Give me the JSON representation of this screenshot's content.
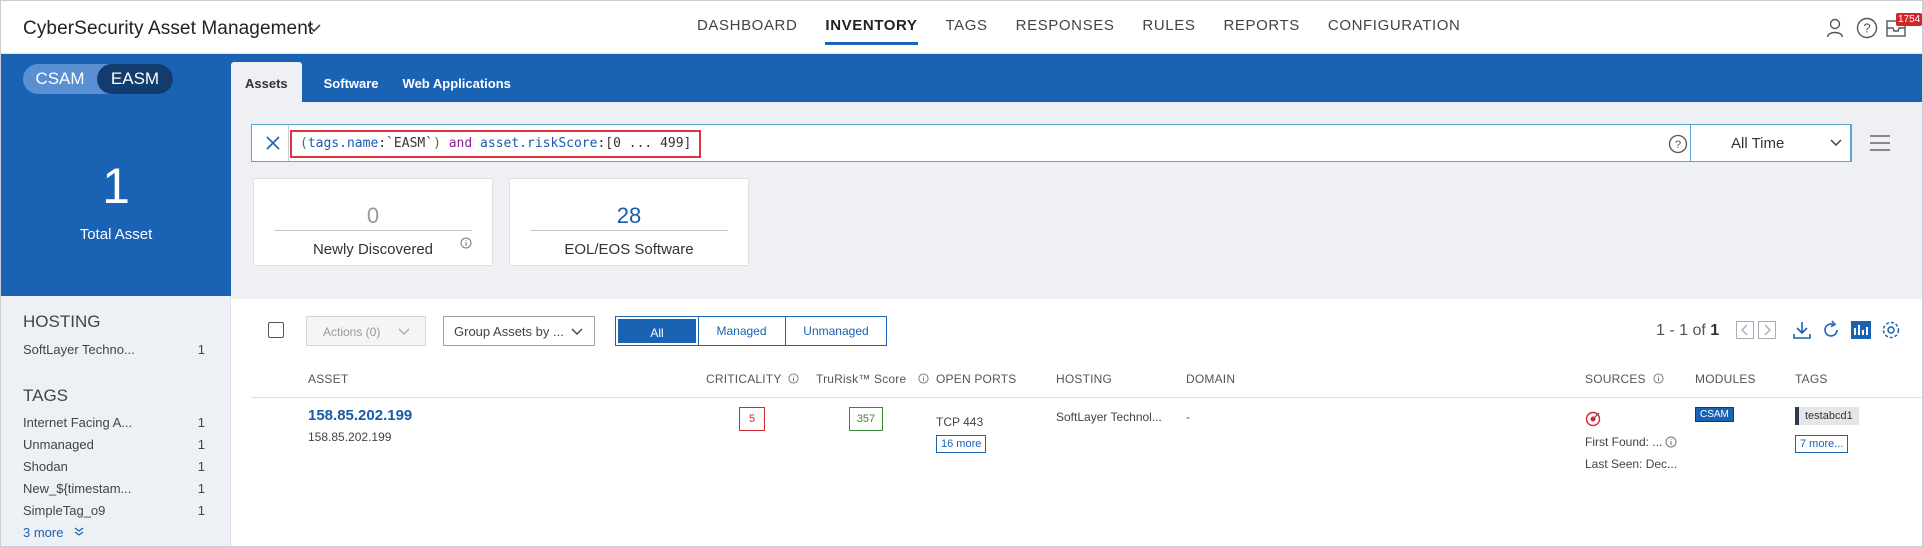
{
  "app": {
    "title": "CyberSecurity Asset Management",
    "notification_count": "1754"
  },
  "nav": [
    {
      "label": "DASHBOARD",
      "active": false
    },
    {
      "label": "INVENTORY",
      "active": true
    },
    {
      "label": "TAGS",
      "active": false
    },
    {
      "label": "RESPONSES",
      "active": false
    },
    {
      "label": "RULES",
      "active": false
    },
    {
      "label": "REPORTS",
      "active": false
    },
    {
      "label": "CONFIGURATION",
      "active": false
    }
  ],
  "mode_toggle": {
    "csam": "CSAM",
    "easm": "EASM",
    "selected": "EASM"
  },
  "subtabs": [
    {
      "label": "Assets",
      "active": true
    },
    {
      "label": "Software",
      "active": false
    },
    {
      "label": "Web Applications",
      "active": false
    }
  ],
  "summary": {
    "total": "1",
    "total_label": "Total Asset"
  },
  "search": {
    "q_open": "(",
    "q_key1": "tags.name",
    "q_colon1": ":`EASM`",
    "q_close": ")",
    "q_and": " and ",
    "q_key2": "asset.riskScore",
    "q_range": ":[0 ... 499]",
    "time_range": "All Time"
  },
  "cards": [
    {
      "value": "0",
      "label": "Newly Discovered"
    },
    {
      "value": "28",
      "label": "EOL/EOS Software"
    }
  ],
  "filters": {
    "hosting_title": "HOSTING",
    "hosting": [
      {
        "label": "SoftLayer Techno...",
        "count": "1"
      }
    ],
    "tags_title": "TAGS",
    "tags": [
      {
        "label": "Internet Facing A...",
        "count": "1"
      },
      {
        "label": "Unmanaged",
        "count": "1"
      },
      {
        "label": "Shodan",
        "count": "1"
      },
      {
        "label": "New_${timestam...",
        "count": "1"
      },
      {
        "label": "SimpleTag_o9",
        "count": "1"
      }
    ],
    "more": "3 more"
  },
  "toolbar": {
    "actions": "Actions (0)",
    "group_by": "Group Assets by ...",
    "segments": [
      "All",
      "Managed",
      "Unmanaged"
    ],
    "pager_range": "1 - 1 of",
    "pager_total": "1"
  },
  "columns": {
    "asset": "ASSET",
    "criticality": "CRITICALITY",
    "trurisk": "TruRisk™ Score",
    "open_ports": "OPEN PORTS",
    "hosting": "HOSTING",
    "domain": "DOMAIN",
    "sources": "SOURCES",
    "modules": "MODULES",
    "tags": "TAGS"
  },
  "rows": [
    {
      "asset_name": "158.85.202.199",
      "asset_ip": "158.85.202.199",
      "criticality": "5",
      "score": "357",
      "port": "TCP 443",
      "ports_more": "16 more",
      "hosting": "SoftLayer Technol...",
      "domain": "-",
      "first_found": "First Found: ...",
      "last_seen": "Last Seen: Dec...",
      "module": "CSAM",
      "tag": "testabcd1",
      "tags_more": "7 more..."
    }
  ],
  "colors": {
    "brand_blue": "#1a62b3",
    "critical_red": "#d1262b",
    "score_green": "#3b8a3b"
  }
}
